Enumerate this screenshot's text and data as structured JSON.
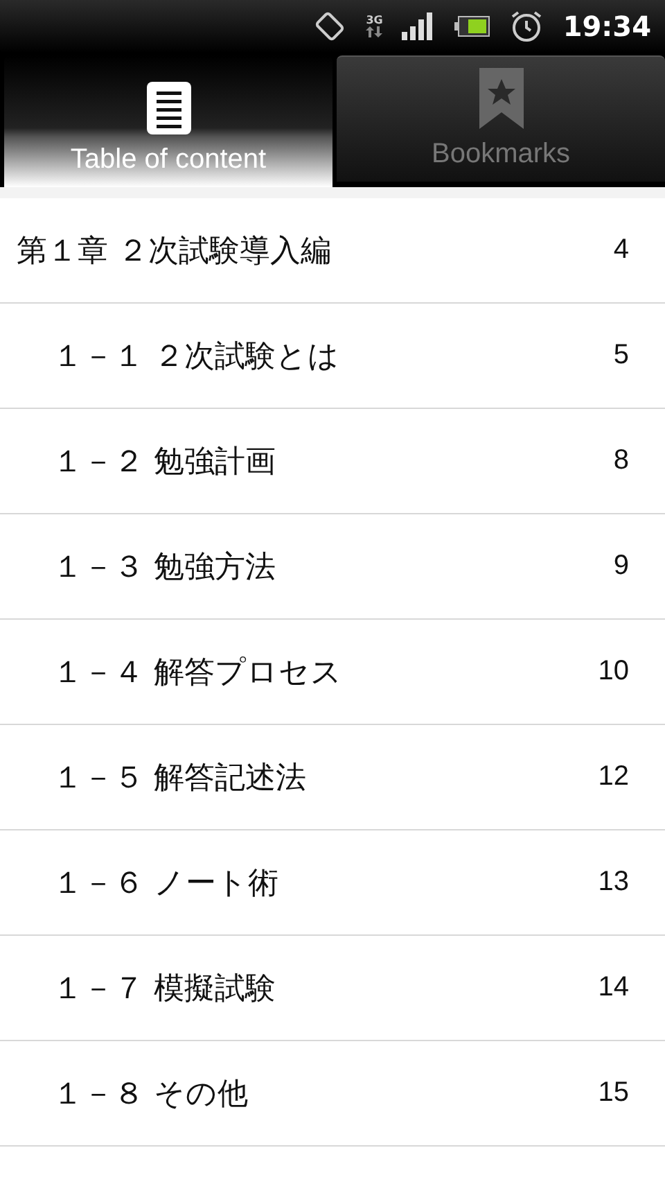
{
  "status_bar": {
    "network": "3G",
    "time": "19:34"
  },
  "tabs": [
    {
      "label": "Table of content",
      "selected": true,
      "kind": "toc"
    },
    {
      "label": "Bookmarks",
      "selected": false,
      "kind": "bookmark"
    }
  ],
  "toc": [
    {
      "title": "第１章 ２次試験導入編",
      "page": "4",
      "children": [
        {
          "title": "１－１ ２次試験とは",
          "page": "5"
        },
        {
          "title": "１－２ 勉強計画",
          "page": "8"
        },
        {
          "title": "１－３ 勉強方法",
          "page": "9"
        },
        {
          "title": "１－４ 解答プロセス",
          "page": "10"
        },
        {
          "title": "１－５ 解答記述法",
          "page": "12"
        },
        {
          "title": "１－６ ノート術",
          "page": "13"
        },
        {
          "title": "１－７ 模擬試験",
          "page": "14"
        },
        {
          "title": "１－８ その他",
          "page": "15"
        }
      ]
    }
  ]
}
